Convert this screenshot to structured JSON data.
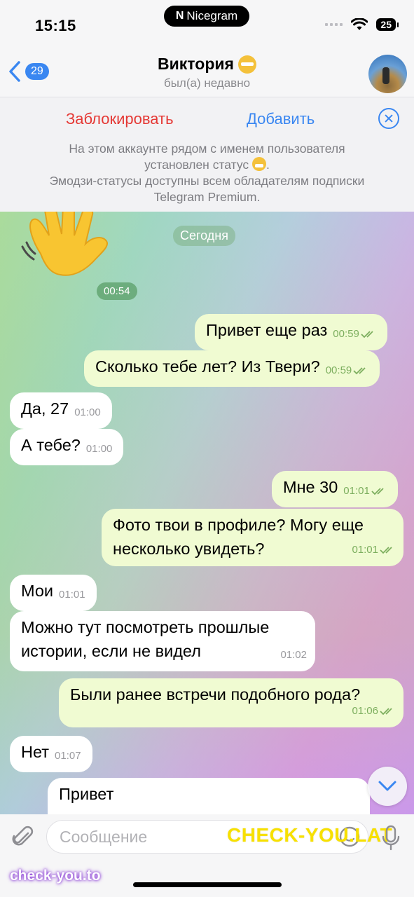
{
  "status_bar": {
    "time": "15:15",
    "island_label": "Nicegram",
    "battery": "25"
  },
  "header": {
    "back_count": "29",
    "title": "Виктория",
    "subtitle": "был(а) недавно"
  },
  "banner": {
    "block_label": "Заблокировать",
    "add_label": "Добавить",
    "info_line1": "На этом аккаунте рядом с именем пользователя",
    "info_line2": "установлен статус",
    "info_line3": "Эмодзи-статусы доступны всем обладателям подписки",
    "info_line4": "Telegram Premium."
  },
  "chat": {
    "date_label": "Сегодня",
    "sticker_time": "00:54",
    "messages": [
      {
        "dir": "out",
        "text": "Привет еще раз",
        "time": "00:59"
      },
      {
        "dir": "out",
        "text": "Сколько тебе лет? Из Твери?",
        "time": "00:59"
      },
      {
        "dir": "in",
        "text": "Да, 27",
        "time": "01:00"
      },
      {
        "dir": "in",
        "text": "А тебе?",
        "time": "01:00"
      },
      {
        "dir": "out",
        "text": "Мне 30",
        "time": "01:01"
      },
      {
        "dir": "out",
        "text": "Фото твои в профиле? Могу еще несколько увидеть?",
        "line1": "Фото твои в профиле? Могу еще",
        "line2": "несколько увидеть?",
        "time": "01:01"
      },
      {
        "dir": "in",
        "text": "Мои",
        "time": "01:01"
      },
      {
        "dir": "in",
        "text": "Можно тут посмотреть прошлые истории, если не видел",
        "line1": "Можно тут посмотреть прошлые",
        "line2": "истории, если не видел",
        "time": "01:02"
      },
      {
        "dir": "out",
        "text": "Были ранее встречи подобного рода?",
        "time": "01:06"
      },
      {
        "dir": "in",
        "text": "Нет",
        "time": "01:07"
      },
      {
        "dir": "in",
        "text": "Привет",
        "time": ""
      }
    ]
  },
  "input": {
    "placeholder": "Сообщение"
  },
  "watermarks": {
    "top": "CHECK-YOU.LAT",
    "bottom": "check-you.to"
  },
  "colors": {
    "accent": "#3a87f1",
    "danger": "#e53935",
    "outgoing_bubble": "#f0fbd2",
    "incoming_bubble": "#ffffff"
  },
  "icons": [
    "back-chevron-icon",
    "emoji-status-icon",
    "close-icon",
    "waving-hand-sticker",
    "read-checks-icon",
    "chevron-down-icon",
    "paperclip-icon",
    "sticker-icon",
    "microphone-icon"
  ]
}
